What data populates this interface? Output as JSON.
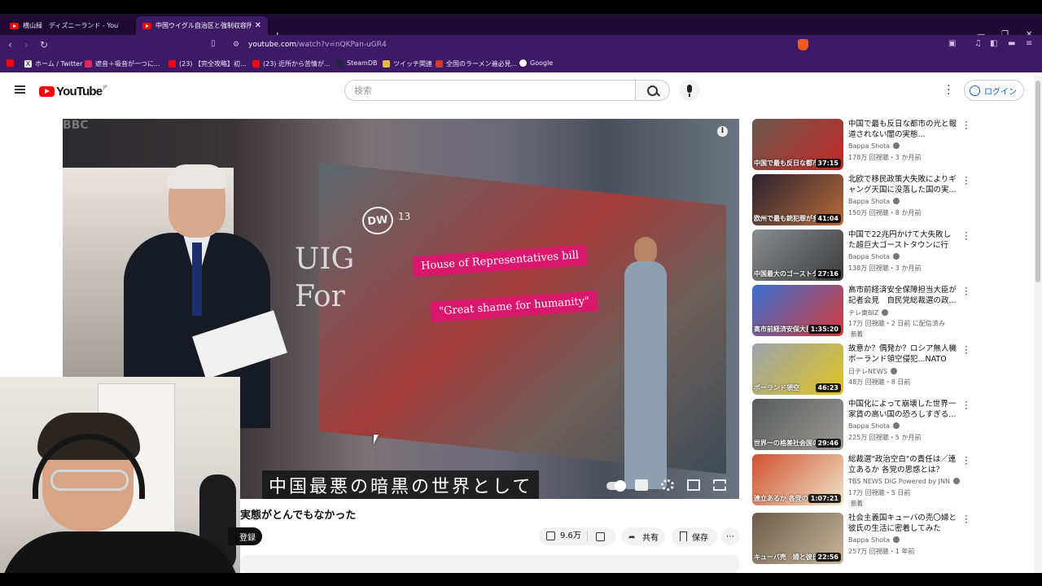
{
  "browser": {
    "tabs": [
      {
        "label": "横山緑　ディズニーランド - YouTube",
        "active": false
      },
      {
        "label": "中国ウイグル自治区と強制収容所の",
        "active": true
      }
    ],
    "url": {
      "host": "youtube.com",
      "path": "/watch?v=nQKPan-uGR4"
    },
    "bookmarks": [
      "ホーム / Twitter",
      "遮音＋吸音が一つに...",
      "(23) 【完全攻略】初...",
      "(23) 近所から苦情が...",
      "SteamDB",
      "ツイッチ関連",
      "全国のラーメン遍必見...",
      "Google"
    ]
  },
  "youtube": {
    "logo_text": "YouTube",
    "region": "JP",
    "search_placeholder": "検索",
    "login_label": "ログイン"
  },
  "video": {
    "in_frame_text": {
      "logo": "BBC",
      "dw": "DW",
      "dw_channel": "13",
      "side_lines": [
        "UIG",
        "For"
      ],
      "bar1": "House of Representatives bill",
      "bar2": "\"Great shame for humanity\""
    },
    "subtitle": "中国最悪の暗黒の世界として",
    "title": "実態がとんでもなかった",
    "subscribe_label": "登録",
    "like_count": "9.6万",
    "share_label": "共有",
    "save_label": "保存"
  },
  "recommendations": [
    {
      "title": "中国で最も反日な都市の光と報道されない闇の実態...",
      "channel": "Bappa Shota",
      "meta": "178万 回視聴・3 か月前",
      "duration": "37:15",
      "overlay": "中国で最も反日な都市",
      "badge": "",
      "thumb_colors": [
        "#6a5a4e",
        "#c42626"
      ]
    },
    {
      "title": "北欧で移民政策大失敗によりギャング天国に没落した国の実...",
      "channel": "Bappa Shota",
      "meta": "150万 回視聴・8 か月前",
      "duration": "41:04",
      "overlay": "欧州で最も銃犯罪が多い",
      "badge": "",
      "thumb_colors": [
        "#2a2230",
        "#b96b3a"
      ]
    },
    {
      "title": "中国で22兆円かけて大失敗した超巨大ゴーストタウンに行っ...",
      "channel": "Bappa Shota",
      "meta": "138万 回視聴・3 か月前",
      "duration": "27:16",
      "overlay": "中国最大のゴーストタウン",
      "badge": "",
      "thumb_colors": [
        "#8a8d90",
        "#3a3c3e"
      ]
    },
    {
      "title": "高市前経済安全保障担当大臣が記者会見　自民党総裁選の政...",
      "channel": "テレ東BIZ",
      "meta": "17万 回視聴・2 日前 に配信済み",
      "duration": "1:35:20",
      "overlay": "高市前経済安保大臣",
      "badge": "新着",
      "thumb_colors": [
        "#3a6fd0",
        "#d63b3b"
      ]
    },
    {
      "title": "故意か？偶発か？ロシア無人機ポーランド領空侵犯...NATO加...",
      "channel": "日テレNEWS",
      "meta": "48万 回視聴・8 日前",
      "duration": "46:23",
      "overlay": "ポーランド領空",
      "badge": "",
      "thumb_colors": [
        "#9aa4ad",
        "#e0c321"
      ]
    },
    {
      "title": "中国化によって崩壊した世界一家賃の高い国の恐ろしすぎる...",
      "channel": "Bappa Shota",
      "meta": "225万 回視聴・5 か月前",
      "duration": "29:46",
      "overlay": "世界一の格差社会国の実",
      "badge": "",
      "thumb_colors": [
        "#575a5c",
        "#9c9a94"
      ]
    },
    {
      "title": "総裁選\"政治空白\"の責任は／連立あるか 各党の思惑とは？【...",
      "channel": "TBS NEWS DIG Powered by JNN",
      "meta": "17万 回視聴・5 日前",
      "duration": "1:07:21",
      "overlay": "連立あるか 各党の思",
      "badge": "新着",
      "thumb_colors": [
        "#d05030",
        "#f0e5c8"
      ]
    },
    {
      "title": "社会主義国キューバの売〇婦と彼氏の生活に密着してみた",
      "channel": "Bappa Shota",
      "meta": "257万 回視聴・1 年前",
      "duration": "22:56",
      "overlay": "キューバ売　婦と彼氏のリア",
      "badge": "",
      "thumb_colors": [
        "#6b5a48",
        "#c8b79c"
      ]
    }
  ]
}
